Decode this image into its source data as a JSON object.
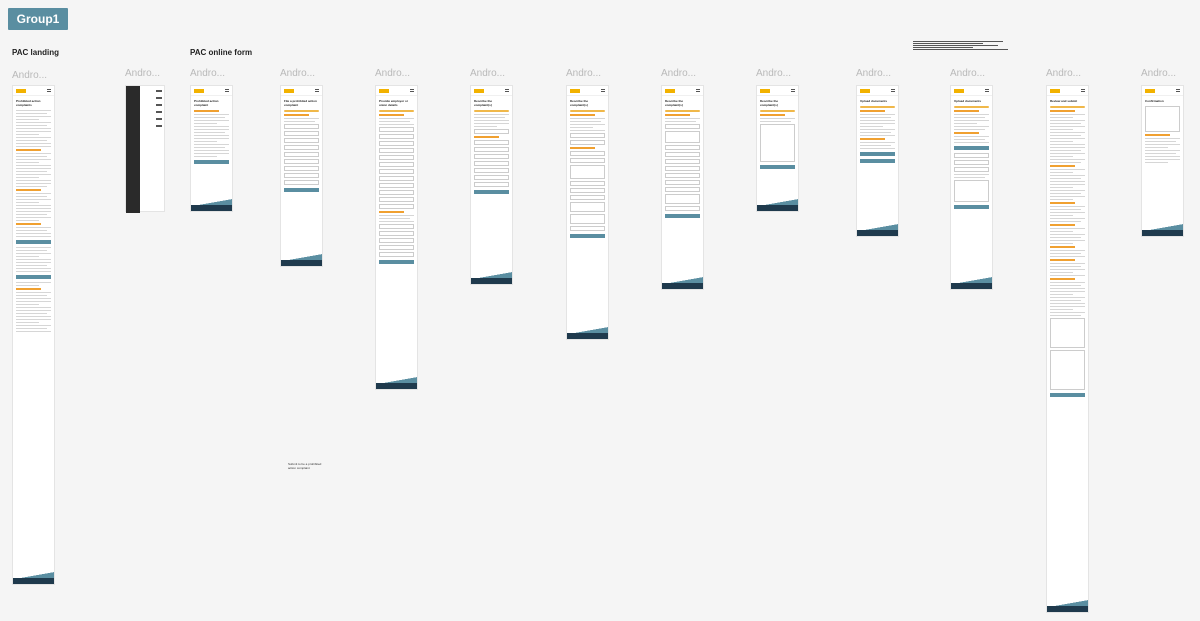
{
  "group": {
    "label": "Group1"
  },
  "sections": {
    "landing": "PAC landing",
    "online_form": "PAC online form"
  },
  "frames": [
    {
      "label": "Andro...",
      "title": "Prohibited action complaints"
    },
    {
      "label": "Andro...",
      "title": ""
    },
    {
      "label": "Andro...",
      "title": "Prohibited action complaint"
    },
    {
      "label": "Andro...",
      "title": "File a prohibited action complaint"
    },
    {
      "label": "Andro...",
      "title": "Provide employer or union details"
    },
    {
      "label": "Andro...",
      "title": "Describe the complaint(s)"
    },
    {
      "label": "Andro...",
      "title": "Describe the complaint(s)"
    },
    {
      "label": "Andro...",
      "title": "Describe the complaint(s)"
    },
    {
      "label": "Andro...",
      "title": "Describe the complaint(s)"
    },
    {
      "label": "Andro...",
      "title": "Upload documents"
    },
    {
      "label": "Andro...",
      "title": "Upload documents"
    },
    {
      "label": "Andro...",
      "title": "Review and submit"
    },
    {
      "label": "Andro...",
      "title": "Confirmation"
    }
  ],
  "notes": {
    "bottom_note": "Submit to be a prohibited action complaint"
  },
  "colors": {
    "accent": "#5a8ea1",
    "brand": "#f2b200",
    "progress": "#f0a030",
    "footer": "#1f3a4d"
  }
}
